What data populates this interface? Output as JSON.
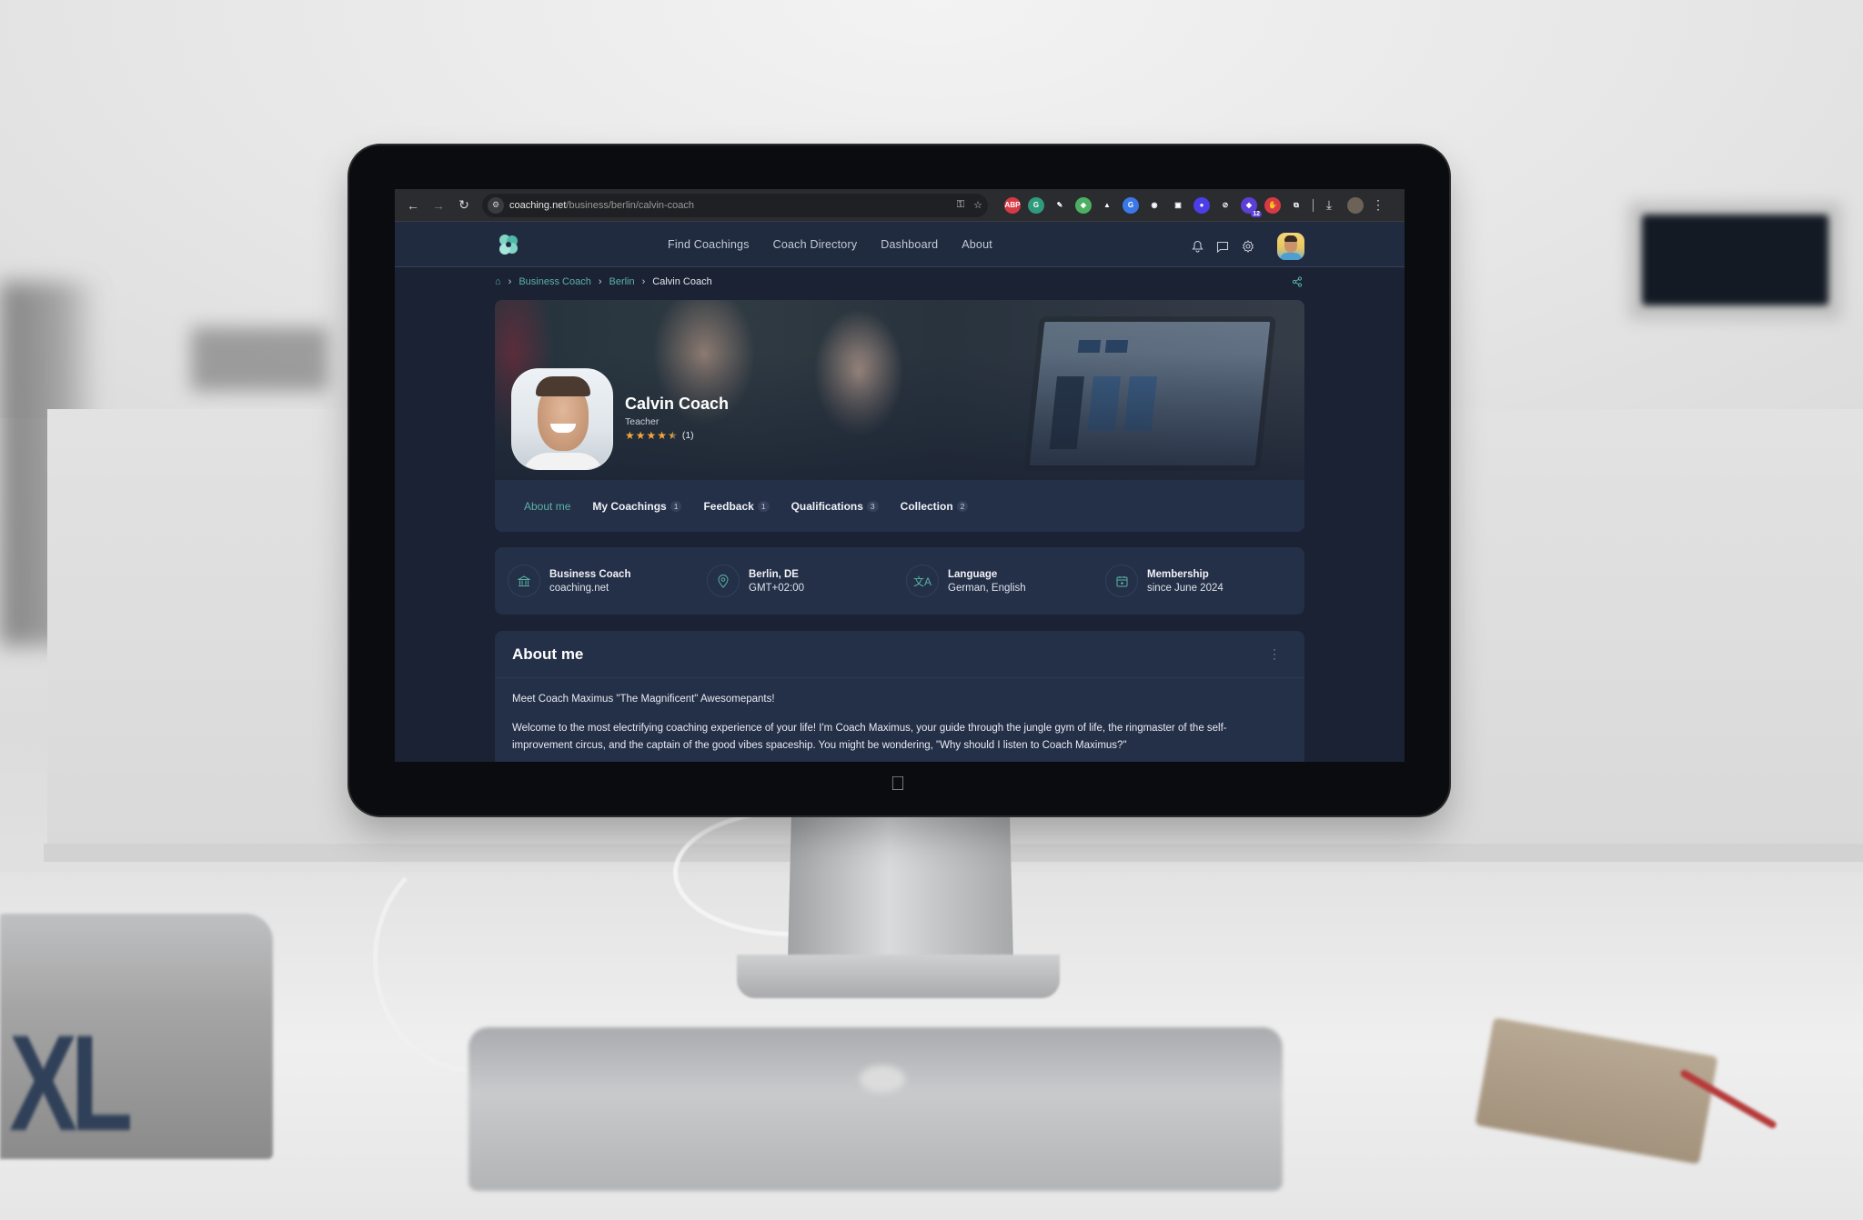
{
  "browser": {
    "url_domain": "coaching.net",
    "url_path": "/business/berlin/calvin-coach",
    "nav": {
      "back": "←",
      "forward": "→",
      "reload": "↻"
    },
    "omnibox_icons": [
      "key-icon",
      "star-icon"
    ],
    "extensions": [
      {
        "name": "adblock-plus",
        "label": "ABP",
        "color": "#d63a45"
      },
      {
        "name": "grammarly",
        "label": "G",
        "color": "#2f9a7d"
      },
      {
        "name": "color-picker",
        "label": "✎",
        "color": "#2b2c2f"
      },
      {
        "name": "green-ext",
        "label": "◆",
        "color": "#4caf62"
      },
      {
        "name": "vue-devtools",
        "label": "▲",
        "color": "#2b2c2f"
      },
      {
        "name": "google-translate",
        "label": "G",
        "color": "#3b78e7"
      },
      {
        "name": "eye-ext",
        "label": "◉",
        "color": "#2b2c2f"
      },
      {
        "name": "camera-ext",
        "label": "▣",
        "color": "#2b2c2f"
      },
      {
        "name": "purple-ext",
        "label": "●",
        "color": "#4b3ee6"
      },
      {
        "name": "compass-ext",
        "label": "⊘",
        "color": "#2b2c2f"
      },
      {
        "name": "badge-ext",
        "label": "◆",
        "color": "#5b3fd6",
        "badge": "12"
      },
      {
        "name": "hand-ext",
        "label": "✋",
        "color": "#d63a45"
      },
      {
        "name": "extensions-puzzle",
        "label": "⧉",
        "color": "#2b2c2f"
      }
    ],
    "download_icon": "⤓",
    "menu_icon": "⋮"
  },
  "header": {
    "nav": [
      "Find Coachings",
      "Coach Directory",
      "Dashboard",
      "About"
    ],
    "icons": [
      "bell-icon",
      "chat-icon",
      "gear-icon"
    ]
  },
  "breadcrumb": {
    "items": [
      "Business Coach",
      "Berlin"
    ],
    "current": "Calvin Coach"
  },
  "profile": {
    "name": "Calvin Coach",
    "role": "Teacher",
    "rating": 4.5,
    "rating_count": "(1)"
  },
  "tabs": [
    {
      "label": "About me",
      "count": null,
      "active": true
    },
    {
      "label": "My Coachings",
      "count": "1"
    },
    {
      "label": "Feedback",
      "count": "1"
    },
    {
      "label": "Qualifications",
      "count": "3"
    },
    {
      "label": "Collection",
      "count": "2"
    }
  ],
  "info": [
    {
      "icon": "bank-icon",
      "title": "Business Coach",
      "sub": "coaching.net"
    },
    {
      "icon": "location-pin-icon",
      "title": "Berlin, DE",
      "sub": "GMT+02:00"
    },
    {
      "icon": "translate-icon",
      "title": "Language",
      "sub": "German, English"
    },
    {
      "icon": "calendar-icon",
      "title": "Membership",
      "sub": "since June 2024"
    }
  ],
  "about": {
    "title": "About me",
    "paragraphs": [
      "Meet Coach Maximus \"The Magnificent\" Awesomepants!",
      "Welcome to the most electrifying coaching experience of your life! I'm Coach Maximus, your guide through the jungle gym of life, the ringmaster of the self-improvement circus, and the captain of the good vibes spaceship. You might be wondering, \"Why should I listen to Coach Maximus?\""
    ]
  },
  "colors": {
    "accent": "#5ab3a3",
    "page_bg": "#1a2233",
    "card_bg": "#242f48",
    "header_bg": "#212b40",
    "star": "#f2a63b"
  }
}
